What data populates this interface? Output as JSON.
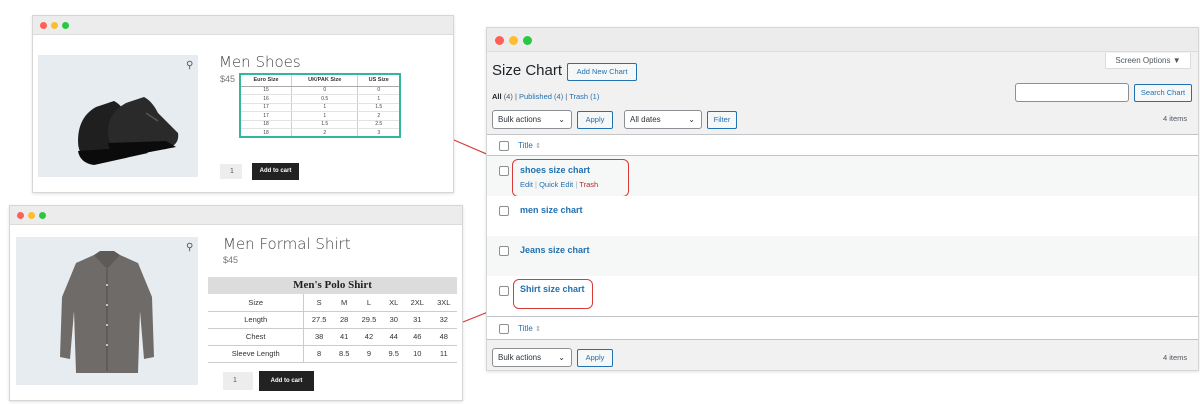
{
  "shoe_window": {
    "title": "Men Shoes",
    "price": "$45",
    "table_headers": [
      "Euro Size",
      "UK/PAK Size",
      "US Size"
    ],
    "table_rows": [
      [
        "15",
        "0",
        "0"
      ],
      [
        "16",
        "0.5",
        "1"
      ],
      [
        "17",
        "1",
        "1.5"
      ],
      [
        "17",
        "1",
        "2"
      ],
      [
        "18",
        "1.5",
        "2.5"
      ],
      [
        "18",
        "2",
        "3"
      ]
    ],
    "qty": "1",
    "add_to_cart": "Add to cart"
  },
  "shirt_window": {
    "title": "Men Formal Shirt",
    "price": "$45",
    "table_caption": "Men's Polo Shirt",
    "table_headers": [
      "Size",
      "S",
      "M",
      "L",
      "XL",
      "2XL",
      "3XL"
    ],
    "table_rows": [
      [
        "Length",
        "27.5",
        "28",
        "29.5",
        "30",
        "31",
        "32"
      ],
      [
        "Chest",
        "38",
        "41",
        "42",
        "44",
        "46",
        "48"
      ],
      [
        "Sleeve Length",
        "8",
        "8.5",
        "9",
        "9.5",
        "10",
        "11"
      ]
    ],
    "qty": "1",
    "add_to_cart": "Add to cart"
  },
  "admin": {
    "screen_options": "Screen Options ▼",
    "page_title": "Size Chart",
    "add_new": "Add New Chart",
    "filters": {
      "all": "All",
      "all_count": "(4)",
      "published": "Published (4)",
      "trash": "Trash (1)",
      "sep": "|"
    },
    "search_button": "Search Chart",
    "search_value": "",
    "bulk_actions": "Bulk actions",
    "apply": "Apply",
    "all_dates": "All dates",
    "filter": "Filter",
    "items_count": "4 items",
    "col_title": "Title",
    "rows": [
      {
        "title": "shoes size chart",
        "actions": [
          "Edit",
          "Quick Edit",
          "Trash"
        ]
      },
      {
        "title": "men size chart"
      },
      {
        "title": "Jeans size chart"
      },
      {
        "title": "Shirt size chart"
      }
    ]
  },
  "colors": {
    "wp_link": "#2271b1",
    "highlight": "#d93a3a",
    "table_border": "#33b79a"
  }
}
